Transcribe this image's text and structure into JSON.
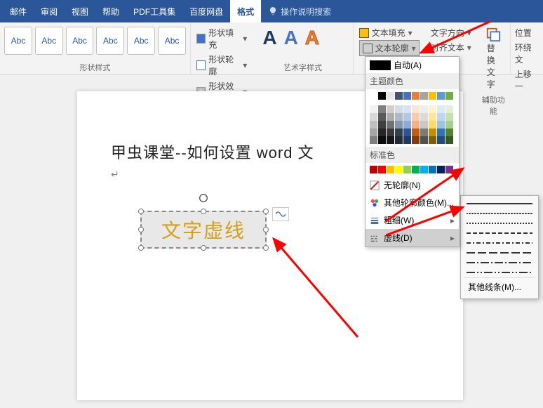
{
  "tabs": [
    "邮件",
    "审阅",
    "视图",
    "帮助",
    "PDF工具集",
    "百度网盘",
    "格式"
  ],
  "tell_me": "操作说明搜索",
  "shape_boxes": [
    "Abc",
    "Abc",
    "Abc",
    "Abc",
    "Abc",
    "Abc"
  ],
  "shape_fill": {
    "fill": "形状填充",
    "outline": "形状轮廓",
    "effect": "形状效果"
  },
  "shape_style_label": "形状样式",
  "wordart_label": "艺术字样式",
  "text_fill": {
    "fill": "文本填充",
    "outline": "文本轮廓"
  },
  "text_align": {
    "direction": "文字方向",
    "align": "对齐文本"
  },
  "aux": {
    "replace": "替换",
    "text": "文字",
    "label": "辅助功能"
  },
  "right": {
    "position": "位置",
    "wrap": "环绕文",
    "forward": "上移一"
  },
  "doc_title": "甲虫课堂--如何设置 word 文",
  "textbox_text": "文字虚线",
  "color_panel": {
    "auto": "自动(A)",
    "theme_header": "主题颜色",
    "std_header": "标准色",
    "no_outline": "无轮廓(N)",
    "more_colors": "其他轮廓颜色(M)...",
    "weight": "粗细(W)",
    "dashes": "虚线(D)"
  },
  "dash_more": "其他线条(M)...",
  "chart_data": null,
  "theme_colors_row1": [
    "#ffffff",
    "#000000",
    "#e7e6e6",
    "#44546a",
    "#4472c4",
    "#ed7d31",
    "#a5a5a5",
    "#ffc000",
    "#5b9bd5",
    "#70ad47"
  ],
  "theme_tints": [
    [
      "#f2f2f2",
      "#7f7f7f",
      "#d0cece",
      "#d6dce4",
      "#d9e2f3",
      "#fbe5d5",
      "#ededed",
      "#fff2cc",
      "#deebf6",
      "#e2efd9"
    ],
    [
      "#d8d8d8",
      "#595959",
      "#aeabab",
      "#adb9ca",
      "#b4c6e7",
      "#f7cbac",
      "#dbdbdb",
      "#fee599",
      "#bdd7ee",
      "#c5e0b3"
    ],
    [
      "#bfbfbf",
      "#3f3f3f",
      "#757070",
      "#8496b0",
      "#8eaadb",
      "#f4b183",
      "#c9c9c9",
      "#ffd965",
      "#9cc3e5",
      "#a8d08d"
    ],
    [
      "#a5a5a5",
      "#262626",
      "#3a3838",
      "#323f4f",
      "#2f5496",
      "#c55a11",
      "#7b7b7b",
      "#bf9000",
      "#2e75b5",
      "#538135"
    ],
    [
      "#7f7f7f",
      "#0c0c0c",
      "#171616",
      "#222a35",
      "#1f3864",
      "#833c0b",
      "#525252",
      "#7f6000",
      "#1e4e79",
      "#375623"
    ]
  ],
  "std_colors": [
    "#c00000",
    "#ff0000",
    "#ffc000",
    "#ffff00",
    "#92d050",
    "#00b050",
    "#00b0f0",
    "#0070c0",
    "#002060",
    "#7030a0"
  ]
}
